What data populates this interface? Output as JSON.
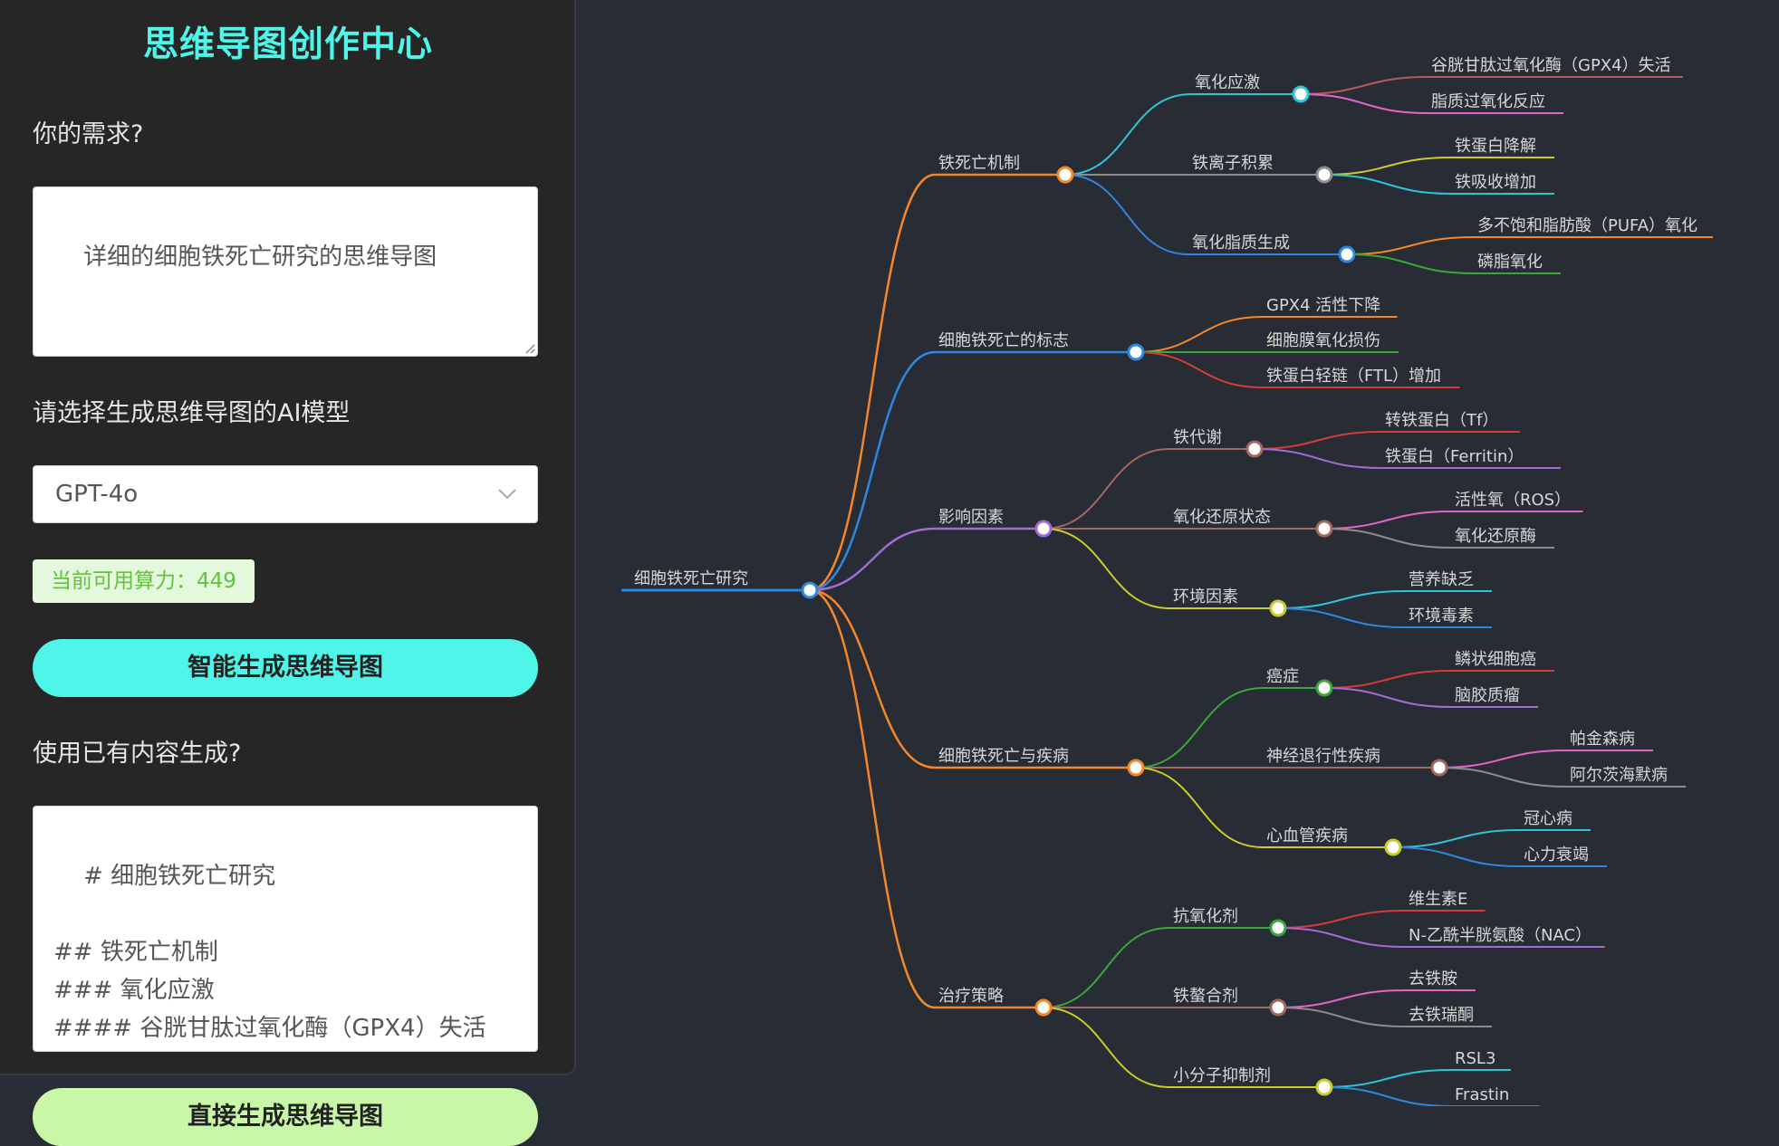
{
  "sidebar": {
    "title": "思维导图创作中心",
    "demand_label": "你的需求?",
    "demand_value": "详细的细胞铁死亡研究的思维导图",
    "model_label": "请选择生成思维导图的AI模型",
    "model_value": "GPT-4o",
    "quota_text": "当前可用算力：449",
    "generate_button": "智能生成思维导图",
    "existing_label": "使用已有内容生成?",
    "existing_value": "# 细胞铁死亡研究\n\n## 铁死亡机制\n### 氧化应激\n#### 谷胱甘肽过氧化酶（GPX4）失活\n#### 脂质过氧化反应\n### 铁离子积累",
    "secondary_button": "直接生成思维导图"
  },
  "icons": {
    "select_arrow": "chevron-down-icon",
    "resize_handle": "resize-handle-icon"
  },
  "mindmap": {
    "root": "细胞铁死亡研究",
    "root_color": "#2e86de",
    "branches": [
      {
        "label": "铁死亡机制",
        "color": "#f5862a",
        "children": [
          {
            "label": "氧化应激",
            "color": "#2ec4d6",
            "leaves": [
              {
                "label": "谷胱甘肽过氧化酶（GPX4）失活",
                "color": "#b8585b"
              },
              {
                "label": "脂质过氧化反应",
                "color": "#e264c8"
              }
            ]
          },
          {
            "label": "铁离子积累",
            "color": "#8c8c8c",
            "leaves": [
              {
                "label": "铁蛋白降解",
                "color": "#c9cc2a"
              },
              {
                "label": "铁吸收增加",
                "color": "#2ec4d6"
              }
            ]
          },
          {
            "label": "氧化脂质生成",
            "color": "#2e86de",
            "leaves": [
              {
                "label": "多不饱和脂肪酸（PUFA）氧化",
                "color": "#f5862a"
              },
              {
                "label": "磷脂氧化",
                "color": "#3aa63a"
              }
            ]
          }
        ]
      },
      {
        "label": "细胞铁死亡的标志",
        "color": "#2e86de",
        "leaves": [
          {
            "label": "GPX4 活性下降",
            "color": "#f5862a"
          },
          {
            "label": "细胞膜氧化损伤",
            "color": "#3aa63a"
          },
          {
            "label": "铁蛋白轻链（FTL）增加",
            "color": "#d63b3b"
          }
        ]
      },
      {
        "label": "影响因素",
        "color": "#a36bd6",
        "children": [
          {
            "label": "铁代谢",
            "color": "#a0685e",
            "leaves": [
              {
                "label": "转铁蛋白（Tf）",
                "color": "#d63b3b"
              },
              {
                "label": "铁蛋白（Ferritin）",
                "color": "#a36bd6"
              }
            ]
          },
          {
            "label": "氧化还原状态",
            "color": "#a0685e",
            "leaves": [
              {
                "label": "活性氧（ROS）",
                "color": "#e264c8"
              },
              {
                "label": "氧化还原酶",
                "color": "#8c8c8c"
              }
            ]
          },
          {
            "label": "环境因素",
            "color": "#c9cc2a",
            "leaves": [
              {
                "label": "营养缺乏",
                "color": "#2ec4d6"
              },
              {
                "label": "环境毒素",
                "color": "#2e86de"
              }
            ]
          }
        ]
      },
      {
        "label": "细胞铁死亡与疾病",
        "color": "#f5862a",
        "children": [
          {
            "label": "癌症",
            "color": "#3aa63a",
            "leaves": [
              {
                "label": "鳞状细胞癌",
                "color": "#d63b3b"
              },
              {
                "label": "脑胶质瘤",
                "color": "#a36bd6"
              }
            ]
          },
          {
            "label": "神经退行性疾病",
            "color": "#a0685e",
            "leaves": [
              {
                "label": "帕金森病",
                "color": "#e264c8"
              },
              {
                "label": "阿尔茨海默病",
                "color": "#8c8c8c"
              }
            ]
          },
          {
            "label": "心血管疾病",
            "color": "#c9cc2a",
            "leaves": [
              {
                "label": "冠心病",
                "color": "#2ec4d6"
              },
              {
                "label": "心力衰竭",
                "color": "#2e86de"
              }
            ]
          }
        ]
      },
      {
        "label": "治疗策略",
        "color": "#f5862a",
        "children": [
          {
            "label": "抗氧化剂",
            "color": "#3aa63a",
            "leaves": [
              {
                "label": "维生素E",
                "color": "#d63b3b"
              },
              {
                "label": "N-乙酰半胱氨酸（NAC）",
                "color": "#a36bd6"
              }
            ]
          },
          {
            "label": "铁螯合剂",
            "color": "#a0685e",
            "leaves": [
              {
                "label": "去铁胺",
                "color": "#e264c8"
              },
              {
                "label": "去铁瑞酮",
                "color": "#8c8c8c"
              }
            ]
          },
          {
            "label": "小分子抑制剂",
            "color": "#c9cc2a",
            "leaves": [
              {
                "label": "RSL3",
                "color": "#2ec4d6"
              },
              {
                "label": "Frastin",
                "color": "#2e86de"
              }
            ]
          }
        ]
      }
    ]
  }
}
